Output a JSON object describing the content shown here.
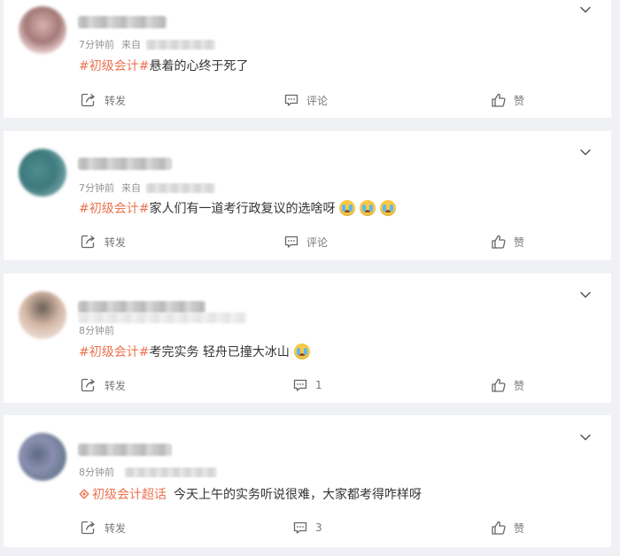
{
  "posts": [
    {
      "time": "7分钟前",
      "source_prefix": "来自",
      "tag": "#初级会计#",
      "text": "悬着的心终于死了",
      "emojis": [],
      "repost_label": "转发",
      "comment_label": "评论",
      "like_label": "赞"
    },
    {
      "time": "7分钟前",
      "source_prefix": "来自",
      "tag": "#初级会计#",
      "text": "家人们有一道考行政复议的选啥呀",
      "emojis": [
        "crying-emoji",
        "crying-emoji",
        "crying-emoji"
      ],
      "repost_label": "转发",
      "comment_label": "评论",
      "like_label": "赞"
    },
    {
      "time": "8分钟前",
      "tag": "#初级会计#",
      "text": "考完实务 轻舟已撞大冰山",
      "emojis": [
        "crying-emoji"
      ],
      "repost_label": "转发",
      "comment_label": "1",
      "like_label": "赞"
    },
    {
      "time": "8分钟前",
      "super_topic": "初级会计超话",
      "text": "今天上午的实务听说很难，大家都考得咋样呀",
      "emojis": [],
      "repost_label": "转发",
      "comment_label": "3",
      "like_label": "赞"
    }
  ],
  "colors": {
    "topic_orange": "#eb7350",
    "meta_gray": "#939393",
    "action_gray": "#777777",
    "page_bg": "#f0f1f4"
  },
  "icons": {
    "repost": "repost-icon",
    "comment": "comment-icon",
    "like": "thumbs-up-icon",
    "menu": "chevron-down-icon",
    "super_topic": "super-topic-diamond-icon"
  }
}
